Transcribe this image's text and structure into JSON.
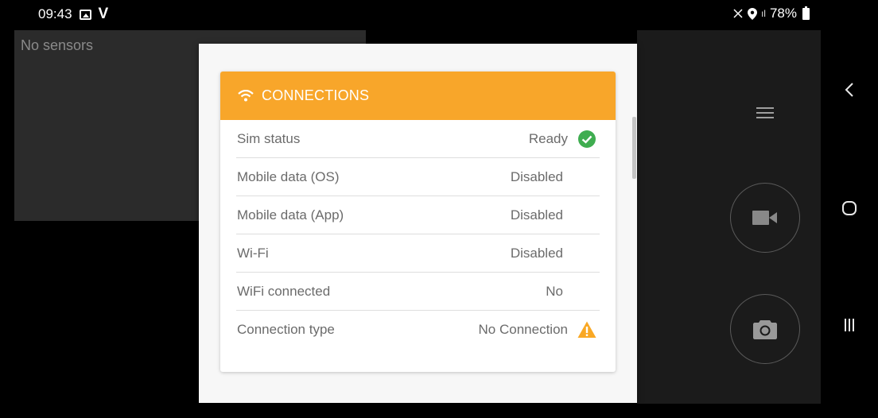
{
  "status_bar": {
    "time": "09:43",
    "carrier_letter": "V",
    "signal_small": "ıl",
    "battery": "78%"
  },
  "sensor_panel": {
    "text": "No sensors"
  },
  "dialog": {
    "title": "CONNECTIONS",
    "rows": [
      {
        "label": "Sim status",
        "value": "Ready",
        "status": "ok"
      },
      {
        "label": "Mobile data (OS)",
        "value": "Disabled",
        "status": "none"
      },
      {
        "label": "Mobile data (App)",
        "value": "Disabled",
        "status": "none"
      },
      {
        "label": "Wi-Fi",
        "value": "Disabled",
        "status": "none"
      },
      {
        "label": "WiFi connected",
        "value": "No",
        "status": "none"
      },
      {
        "label": "Connection type",
        "value": "No Connection",
        "status": "warning"
      }
    ]
  },
  "colors": {
    "header": "#f8a62a",
    "ok": "#3fad50",
    "warning": "#f9a825"
  },
  "icons": {
    "wifi": "wifi-icon",
    "ok": "check-circle-icon",
    "warning": "warning-triangle-icon",
    "menu": "hamburger-menu-icon",
    "video": "video-camera-icon",
    "photo": "photo-camera-icon"
  }
}
